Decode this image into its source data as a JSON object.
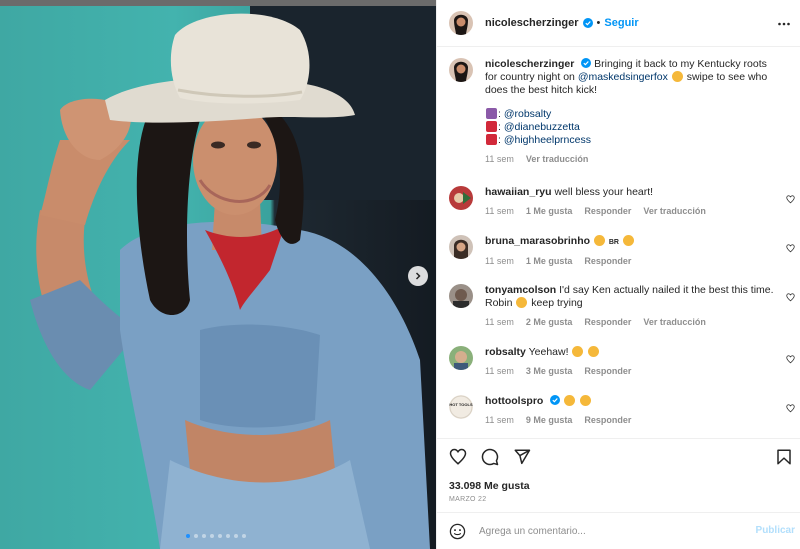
{
  "post": {
    "author": "nicolescherzinger",
    "follow_label": "Seguir",
    "separator": "•",
    "caption": {
      "text_before": "Bringing it back to my Kentucky roots for country night on",
      "mention": "@maskedsingerfox",
      "text_after": "swipe to see who does the best hitch kick!",
      "tags": [
        "@robsalty",
        "@dianebuzzetta",
        "@highheelprncess"
      ],
      "time": "11 sem",
      "translate": "Ver traducción"
    },
    "likes": "33.098 Me gusta",
    "date": "MARZO 22"
  },
  "comments": [
    {
      "user": "hawaiian_ryu",
      "text": "well bless your heart!",
      "time": "11 sem",
      "likes": "1 Me gusta",
      "reply": "Responder",
      "translate": "Ver traducción"
    },
    {
      "user": "bruna_marasobrinho",
      "text": "BR",
      "time": "11 sem",
      "likes": "1 Me gusta",
      "reply": "Responder"
    },
    {
      "user": "tonyamcolson",
      "text_a": "I'd say Ken actually nailed it the best this time.",
      "text_b": "Robin",
      "text_c": "keep trying",
      "time": "11 sem",
      "likes": "2 Me gusta",
      "reply": "Responder",
      "translate": "Ver traducción"
    },
    {
      "user": "robsalty",
      "text": "Yeehaw!",
      "time": "11 sem",
      "likes": "3 Me gusta",
      "reply": "Responder"
    },
    {
      "user": "hottoolspro",
      "avatar_text": "HOT TOOLS",
      "time": "11 sem",
      "likes": "9 Me gusta",
      "reply": "Responder"
    }
  ],
  "composer": {
    "placeholder": "Agrega un comentario...",
    "publish_label": "Publicar"
  },
  "icons": {
    "next": "chevron-right-icon",
    "more": "more-options-icon",
    "like": "heart-icon",
    "comment": "comment-icon",
    "share": "share-icon",
    "save": "bookmark-icon",
    "emoji": "emoji-icon",
    "verified": "verified-badge-icon"
  },
  "colors": {
    "accent": "#0095f6",
    "mention": "#00376b",
    "muted": "#8e8e8e",
    "backdrop": "#43b3ae"
  },
  "carousel": {
    "slides": 8,
    "active": 1
  }
}
